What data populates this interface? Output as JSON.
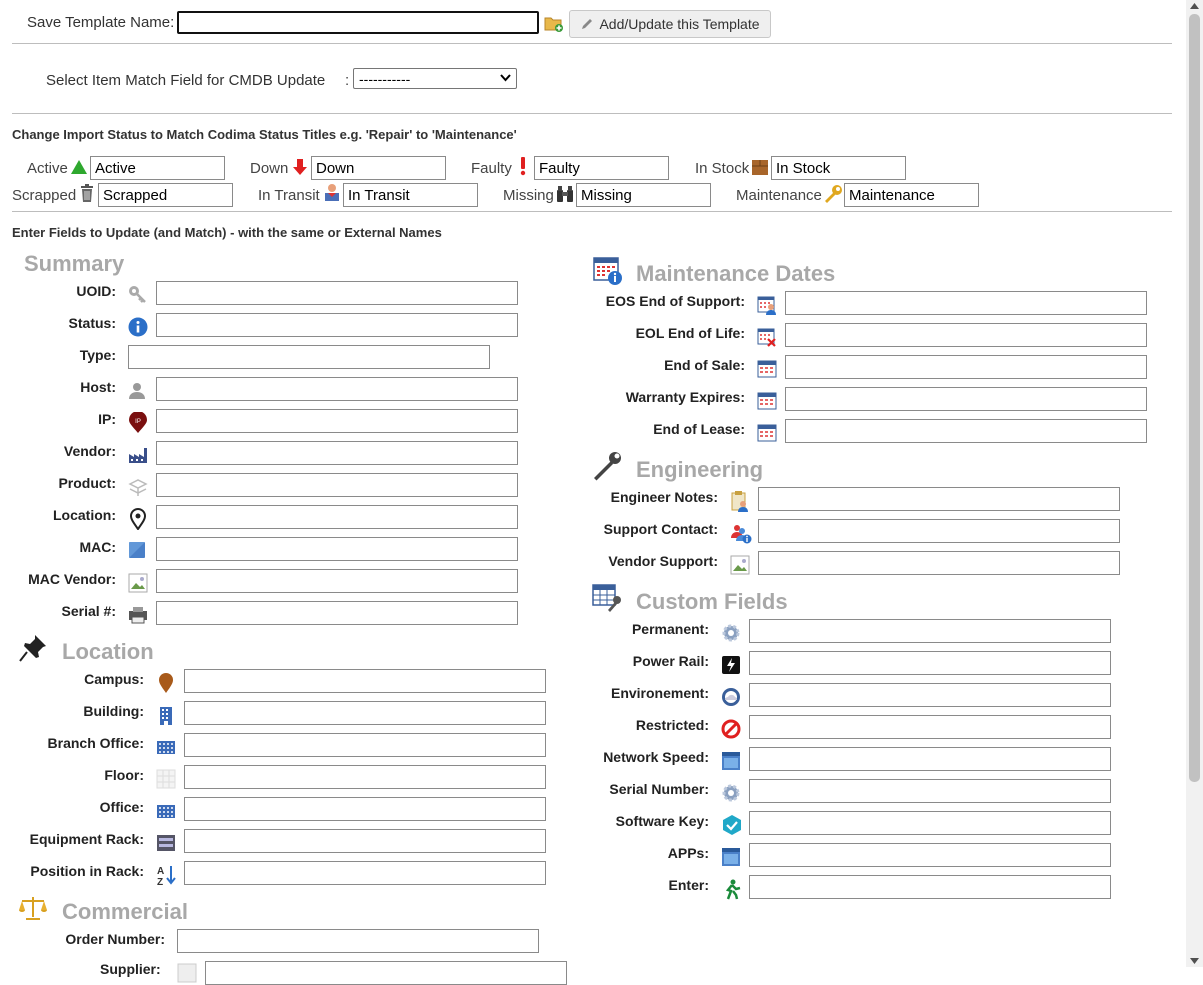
{
  "template": {
    "label": "Save Template Name:",
    "value": "",
    "button": "Add/Update this Template"
  },
  "match_field": {
    "label": "Select Item Match Field for CMDB Update",
    "colon": ":",
    "selected": "-----------"
  },
  "status_map": {
    "title": "Change Import Status to Match Codima Status Titles e.g. 'Repair' to 'Maintenance'",
    "items": [
      {
        "label": "Active",
        "value": "Active",
        "icon": "triangle-up-icon"
      },
      {
        "label": "Down",
        "value": "Down",
        "icon": "arrow-down-icon"
      },
      {
        "label": "Faulty",
        "value": "Faulty",
        "icon": "exclamation-icon"
      },
      {
        "label": "In Stock",
        "value": "In Stock",
        "icon": "box-icon"
      },
      {
        "label": "Scrapped",
        "value": "Scrapped",
        "icon": "trash-icon"
      },
      {
        "label": "In Transit",
        "value": "In Transit",
        "icon": "transit-icon"
      },
      {
        "label": "Missing",
        "value": "Missing",
        "icon": "binoculars-icon"
      },
      {
        "label": "Maintenance",
        "value": "Maintenance",
        "icon": "wrench-icon"
      }
    ]
  },
  "fields_title": "Enter Fields to Update (and Match) - with the same or External Names",
  "summary": {
    "title": "Summary",
    "fields": [
      {
        "label": "UOID:",
        "icon": "key-icon"
      },
      {
        "label": "Status:",
        "icon": "info-icon"
      },
      {
        "label": "Type:",
        "icon": ""
      },
      {
        "label": "Host:",
        "icon": "user-icon"
      },
      {
        "label": "IP:",
        "icon": "ip-pin-icon"
      },
      {
        "label": "Vendor:",
        "icon": "factory-icon"
      },
      {
        "label": "Product:",
        "icon": "product-icon"
      },
      {
        "label": "Location:",
        "icon": "map-pin-icon"
      },
      {
        "label": "MAC:",
        "icon": "square-icon"
      },
      {
        "label": "MAC Vendor:",
        "icon": "image-icon"
      },
      {
        "label": "Serial #:",
        "icon": "printer-icon"
      }
    ]
  },
  "location": {
    "title": "Location",
    "fields": [
      {
        "label": "Campus:",
        "icon": "location-drop-icon"
      },
      {
        "label": "Building:",
        "icon": "building-icon"
      },
      {
        "label": "Branch Office:",
        "icon": "office-icon"
      },
      {
        "label": "Floor:",
        "icon": "floor-icon"
      },
      {
        "label": "Office:",
        "icon": "office-icon"
      },
      {
        "label": "Equipment Rack:",
        "icon": "rack-icon"
      },
      {
        "label": "Position in Rack:",
        "icon": "sort-az-icon"
      }
    ]
  },
  "commercial": {
    "title": "Commercial",
    "fields": [
      {
        "label": "Order Number:",
        "icon": ""
      },
      {
        "label": "Supplier:",
        "icon": "supplier-icon"
      }
    ]
  },
  "maintenance": {
    "title": "Maintenance Dates",
    "fields": [
      {
        "label": "EOS End of Support:",
        "icon": "calendar-user-icon"
      },
      {
        "label": "EOL End of Life:",
        "icon": "calendar-x-icon"
      },
      {
        "label": "End of Sale:",
        "icon": "calendar-icon"
      },
      {
        "label": "Warranty Expires:",
        "icon": "calendar-icon"
      },
      {
        "label": "End of Lease:",
        "icon": "calendar-icon"
      }
    ]
  },
  "engineering": {
    "title": "Engineering",
    "fields": [
      {
        "label": "Engineer Notes:",
        "icon": "clipboard-user-icon"
      },
      {
        "label": "Support Contact:",
        "icon": "contacts-info-icon"
      },
      {
        "label": "Vendor Support:",
        "icon": "image-icon"
      }
    ]
  },
  "custom": {
    "title": "Custom Fields",
    "fields": [
      {
        "label": "Permanent:",
        "icon": "gear-icon"
      },
      {
        "label": "Power Rail:",
        "icon": "lightning-icon"
      },
      {
        "label": "Environement:",
        "icon": "weather-icon"
      },
      {
        "label": "Restricted:",
        "icon": "no-entry-icon"
      },
      {
        "label": "Network Speed:",
        "icon": "window-icon"
      },
      {
        "label": "Serial Number:",
        "icon": "gear-icon"
      },
      {
        "label": "Software Key:",
        "icon": "shield-check-icon"
      },
      {
        "label": "APPs:",
        "icon": "window-icon"
      },
      {
        "label": "Enter:",
        "icon": "exit-man-icon"
      }
    ]
  }
}
